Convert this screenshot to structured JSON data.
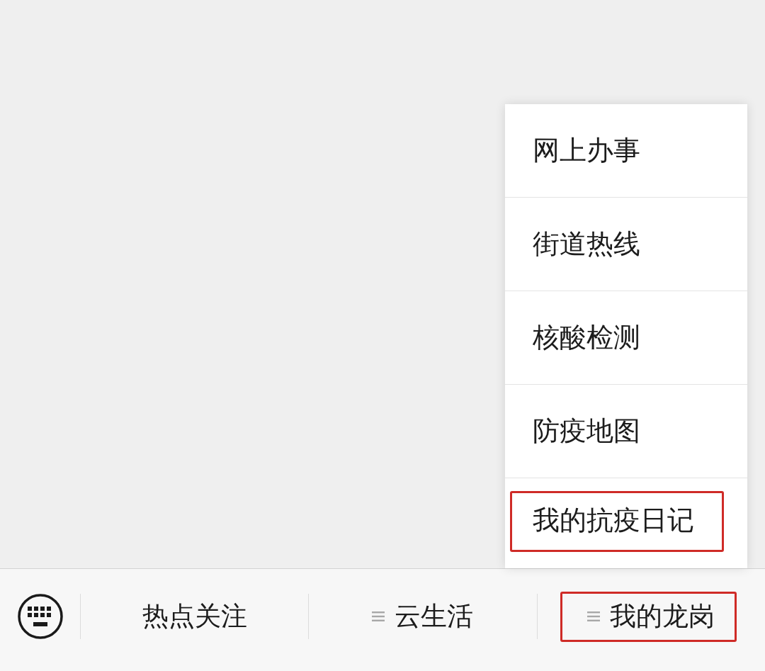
{
  "popup_menu": {
    "items": [
      {
        "label": "网上办事",
        "highlighted": false
      },
      {
        "label": "街道热线",
        "highlighted": false
      },
      {
        "label": "核酸检测",
        "highlighted": false
      },
      {
        "label": "防疫地图",
        "highlighted": false
      },
      {
        "label": "我的抗疫日记",
        "highlighted": true
      }
    ]
  },
  "bottom_bar": {
    "tabs": [
      {
        "label": "热点关注",
        "has_submenu": false,
        "highlighted": false
      },
      {
        "label": "云生活",
        "has_submenu": true,
        "highlighted": false
      },
      {
        "label": "我的龙岗",
        "has_submenu": true,
        "highlighted": true
      }
    ]
  }
}
